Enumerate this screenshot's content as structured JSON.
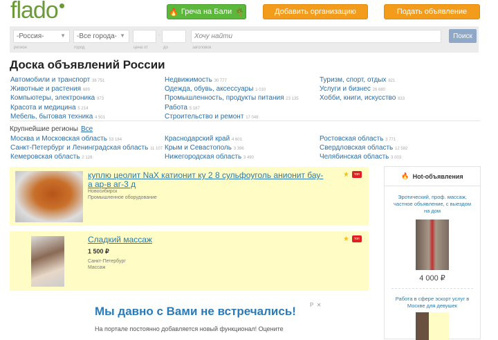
{
  "header": {
    "logo": "flado",
    "promo_button": "Греча на Бали",
    "add_org_button": "Добавить организацию",
    "post_ad_button": "Подать объявление"
  },
  "search": {
    "region_value": "-Россия-",
    "city_value": "-Все города-",
    "price_from_value": "",
    "price_to_value": "",
    "dash": "-",
    "query_placeholder": "Хочу найти",
    "submit": "Поиск",
    "labels": {
      "region": "регион",
      "city": "город",
      "price_from": "цена от",
      "price_to": "до",
      "title": "заголовок"
    }
  },
  "page_title": "Доска объявлений России",
  "categories": [
    [
      {
        "name": "Автомобили и транспорт",
        "count": "38 751"
      },
      {
        "name": "Животные и растения",
        "count": "689"
      },
      {
        "name": "Компьютеры, электроника",
        "count": "973"
      },
      {
        "name": "Красота и медицина",
        "count": "5 214"
      },
      {
        "name": "Мебель, бытовая техника",
        "count": "4 501"
      }
    ],
    [
      {
        "name": "Недвижимость",
        "count": "30 777"
      },
      {
        "name": "Одежда, обувь, аксессуары",
        "count": "1 010"
      },
      {
        "name": "Промышленность, продукты питания",
        "count": "23 135"
      },
      {
        "name": "Работа",
        "count": "5 187"
      },
      {
        "name": "Строительство и ремонт",
        "count": "17 048"
      }
    ],
    [
      {
        "name": "Туризм, спорт, отдых",
        "count": "821"
      },
      {
        "name": "Услуги и бизнес",
        "count": "26 680"
      },
      {
        "name": "Хобби, книги, искусство",
        "count": "833"
      }
    ]
  ],
  "regions": {
    "heading": "Крупнейшие регионы",
    "all_link": "Все",
    "cols": [
      [
        {
          "name": "Москва и Московская область",
          "count": "53 184"
        },
        {
          "name": "Санкт-Петербург и Ленинградская область",
          "count": "11 107"
        },
        {
          "name": "Кемеровская область",
          "count": "2 128"
        }
      ],
      [
        {
          "name": "Краснодарский край",
          "count": "4 601"
        },
        {
          "name": "Крым и Севастополь",
          "count": "3 396"
        },
        {
          "name": "Нижегородская область",
          "count": "3 490"
        }
      ],
      [
        {
          "name": "Ростовская область",
          "count": "3 771"
        },
        {
          "name": "Свердловская область",
          "count": "12 582"
        },
        {
          "name": "Челябинская область",
          "count": "3 003"
        }
      ]
    ]
  },
  "ads": [
    {
      "title": "куплю цеолит NaX катионит ку 2 8 сульфоуголь анионит бау-а ар-в аг-3 д",
      "price": "",
      "city": "Новосибирск",
      "category": "Промышленное оборудование",
      "badge": "топ"
    },
    {
      "title": "Сладкий массаж",
      "price": "1 500 ₽",
      "city": "Санкт-Петербург",
      "category": "Массаж",
      "badge": "топ"
    }
  ],
  "hot": {
    "heading": "Hot-объявления",
    "items": [
      {
        "title": "Эротический, проф. массаж, частное объявление, с выездом на дом",
        "price": "4 000 ₽"
      },
      {
        "title": "Работа в сфере эскорт услуг в Москве для девушек",
        "price": ""
      }
    ]
  },
  "banner": {
    "heading": "Мы давно с Вами не встречались!",
    "text": "На портале постоянно добавляется новый функционал! Оцените",
    "close": "✕",
    "ad_mark": "P"
  }
}
